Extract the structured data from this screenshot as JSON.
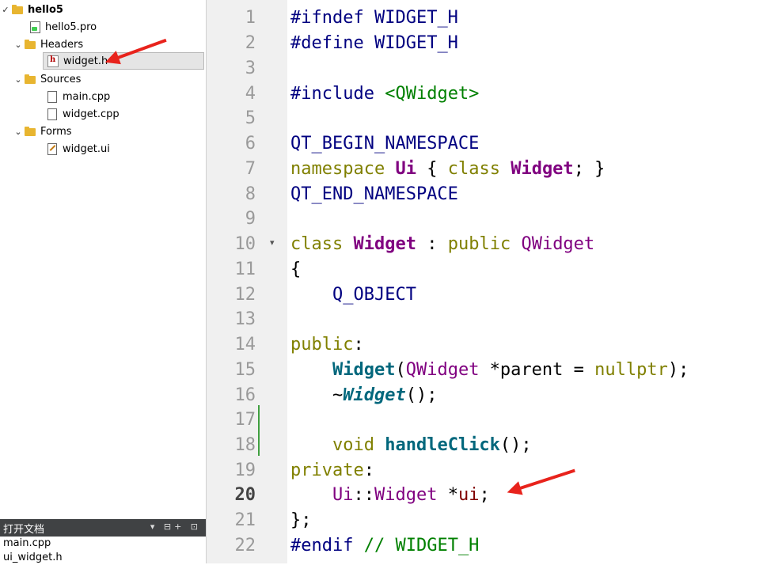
{
  "tree": {
    "project": "hello5",
    "project_file": "hello5.pro",
    "headers_label": "Headers",
    "header_file": "widget.h",
    "sources_label": "Sources",
    "source_main": "main.cpp",
    "source_widget": "widget.cpp",
    "forms_label": "Forms",
    "form_file": "widget.ui"
  },
  "open_docs": {
    "title": "打开文档",
    "items": [
      "main.cpp",
      "ui_widget.h"
    ],
    "controls": "▾ ⊟+ ⊡"
  },
  "editor": {
    "current_line": 20,
    "line_numbers": [
      "1",
      "2",
      "3",
      "4",
      "5",
      "6",
      "7",
      "8",
      "9",
      "10",
      "11",
      "12",
      "13",
      "14",
      "15",
      "16",
      "17",
      "18",
      "19",
      "20",
      "21",
      "22"
    ],
    "fold_marker": "▾",
    "tokens": {
      "ifndef": "#ifndef",
      "define": "#define",
      "guard": "WIDGET_H",
      "include": "#include",
      "include_target": "<QWidget>",
      "begin_ns": "QT_BEGIN_NAMESPACE",
      "namespace_kw": "namespace",
      "ns_name": "Ui",
      "open_brace": "{",
      "class_kw": "class",
      "class_name": "Widget",
      "semicolon_close": "; }",
      "end_ns": "QT_END_NAMESPACE",
      "colon": ":",
      "public_kw": "public",
      "base_class": "QWidget",
      "brace_open": "{",
      "q_object": "Q_OBJECT",
      "public_label": "public",
      "ctor_name": "Widget",
      "paren_open": "(",
      "param_type": "QWidget",
      "param_rest": " *parent = ",
      "nullptr": "nullptr",
      "paren_close_semi": ");",
      "tilde": "~",
      "dtor_name": "Widget",
      "empty_parens_semi": "();",
      "void_kw": "void",
      "method_name": "handleClick",
      "private_label": "private",
      "ui_ns": "Ui",
      "scope": "::",
      "ui_type": "Widget",
      "ptr_star": " *",
      "member": "ui",
      "semi": ";",
      "close_brace_semi": "};",
      "endif": "#endif",
      "endif_comment": "// WIDGET_H"
    }
  },
  "colors": {
    "arrow": "#e8231c",
    "keyword": "#808000",
    "class": "#800080",
    "function": "#00677c"
  }
}
